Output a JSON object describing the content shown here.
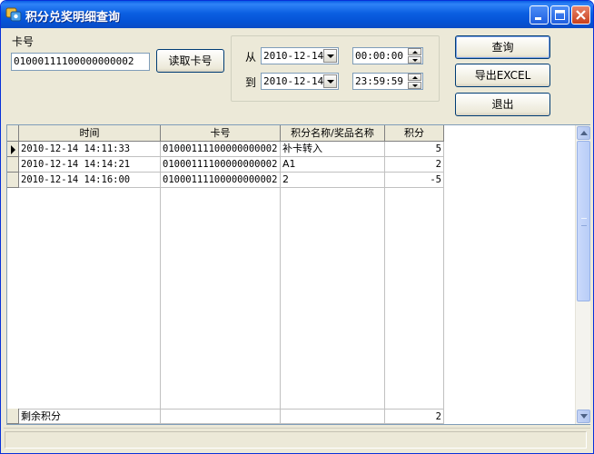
{
  "window": {
    "title": "积分兑奖明细查询"
  },
  "form": {
    "card_label": "卡号",
    "card_value": "01000111100000000002",
    "read_card_button": "读取卡号",
    "from_label": "从",
    "to_label": "到",
    "from_date": "2010-12-14",
    "from_time": "00:00:00",
    "to_date": "2010-12-14",
    "to_time": "23:59:59"
  },
  "actions": {
    "query": "查询",
    "export": "导出EXCEL",
    "exit": "退出"
  },
  "grid": {
    "columns": [
      "时间",
      "卡号",
      "积分名称/奖品名称",
      "积分"
    ],
    "rows": [
      {
        "time": "2010-12-14 14:11:33",
        "card": "01000111100000000002",
        "name": "补卡转入",
        "points": "5"
      },
      {
        "time": "2010-12-14 14:14:21",
        "card": "01000111100000000002",
        "name": "A1",
        "points": "2"
      },
      {
        "time": "2010-12-14 14:16:00",
        "card": "01000111100000000002",
        "name": "2",
        "points": "-5"
      }
    ],
    "footer": {
      "label": "剩余积分",
      "points": "2"
    }
  }
}
